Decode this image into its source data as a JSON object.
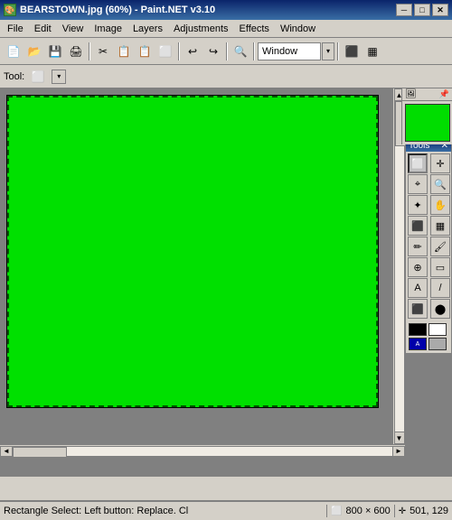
{
  "title": {
    "text": "BEARSTOWN.jpg (60%) - Paint.NET v3.10",
    "icon": "🖼"
  },
  "title_buttons": {
    "minimize": "─",
    "maximize": "□",
    "close": "✕"
  },
  "menu": {
    "items": [
      "File",
      "Edit",
      "View",
      "Image",
      "Layers",
      "Adjustments",
      "Effects",
      "Window"
    ]
  },
  "toolbar": {
    "window_label": "Window",
    "buttons": [
      "📄",
      "📂",
      "💾",
      "🖨",
      "✂",
      "📋",
      "📋",
      "🔄",
      "↩",
      "↪",
      "🔍",
      "",
      "",
      "",
      "",
      "",
      "",
      "",
      "",
      "",
      ""
    ]
  },
  "tool_select": {
    "label": "Tool:",
    "icon": "⬜"
  },
  "tools_panel": {
    "title": "Tools",
    "tools": [
      {
        "name": "rectangle-select",
        "symbol": "⬜"
      },
      {
        "name": "move",
        "symbol": "✛"
      },
      {
        "name": "lasso",
        "symbol": "🔆"
      },
      {
        "name": "zoom",
        "symbol": "🔍"
      },
      {
        "name": "magic-wand",
        "symbol": "⭐"
      },
      {
        "name": "pan",
        "symbol": "✋"
      },
      {
        "name": "paint-bucket",
        "symbol": "🪣"
      },
      {
        "name": "gradient",
        "symbol": "▦"
      },
      {
        "name": "pencil",
        "symbol": "✏"
      },
      {
        "name": "brush",
        "symbol": "🖌"
      },
      {
        "name": "clone-stamp",
        "symbol": "⊕"
      },
      {
        "name": "eraser",
        "symbol": "▭"
      },
      {
        "name": "text",
        "symbol": "A"
      },
      {
        "name": "line",
        "symbol": "/"
      },
      {
        "name": "shapes",
        "symbol": "⬛"
      },
      {
        "name": "ellipse",
        "symbol": "⬤"
      }
    ]
  },
  "thumbnail": {
    "title": "🖼"
  },
  "canvas": {
    "bg_color": "#00dd00",
    "zoom": "60%"
  },
  "status": {
    "tool_text": "Rectangle Select: Left button: Replace. Cl",
    "size_icon": "⬜",
    "size": "800 × 600",
    "pos_icon": "✛",
    "position": "501, 129"
  },
  "colors": {
    "primary": "#000000",
    "secondary": "#ffffff"
  }
}
